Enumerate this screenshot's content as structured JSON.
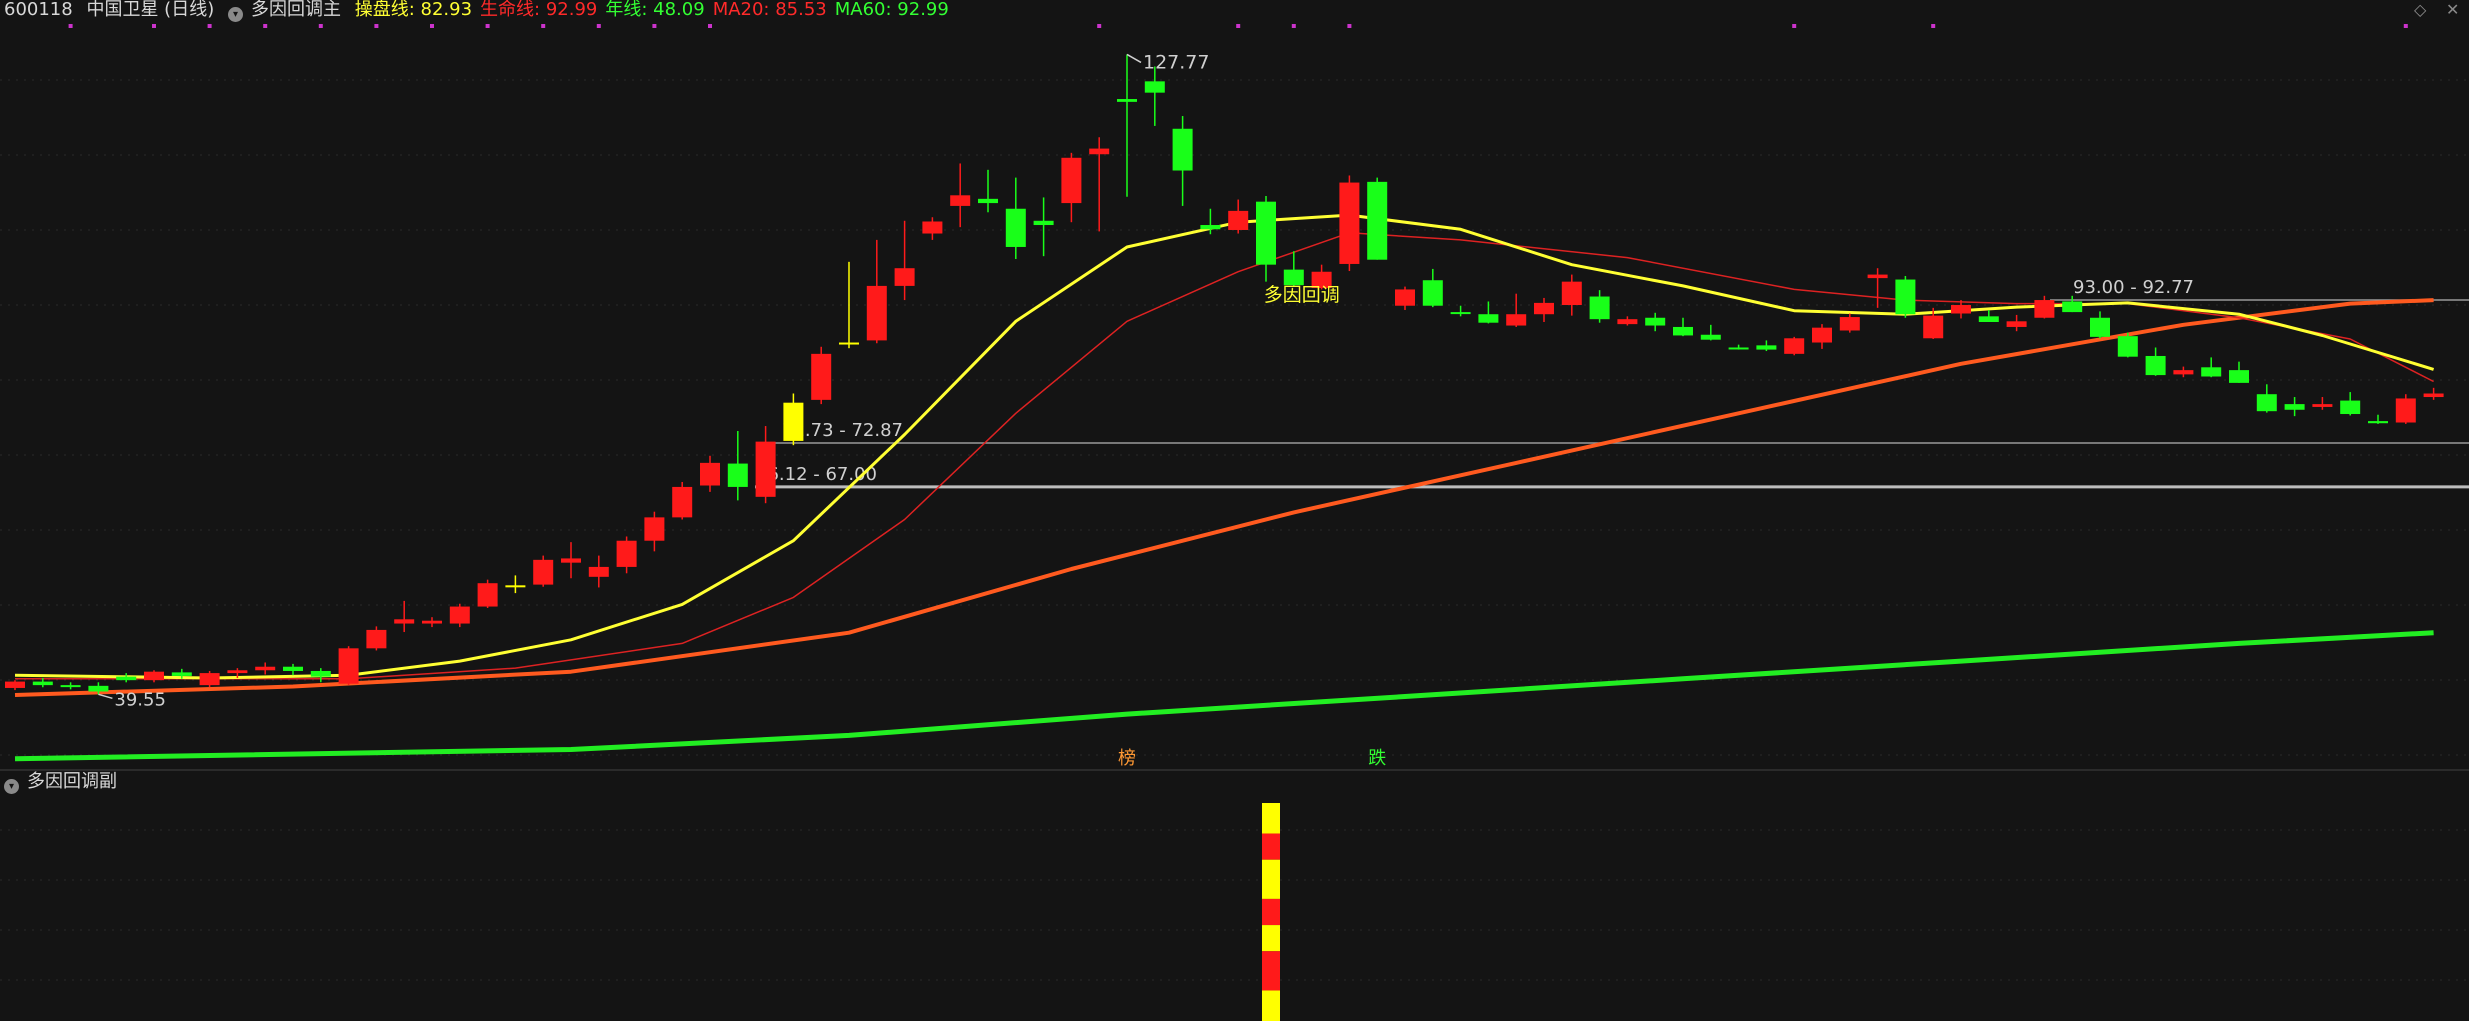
{
  "header": {
    "code": "600118",
    "name": "中国卫星 (日线)",
    "indicator": "多因回调主",
    "metrics": [
      {
        "label": "操盘线",
        "value": "82.93",
        "color": "#ffff33"
      },
      {
        "label": "生命线",
        "value": "92.99",
        "color": "#ff2a2a"
      },
      {
        "label": "年线",
        "value": "48.09",
        "color": "#33ff33"
      },
      {
        "label": "MA20",
        "value": "85.53",
        "color": "#ff2a2a"
      },
      {
        "label": "MA60",
        "value": "92.99",
        "color": "#33ff33"
      }
    ]
  },
  "sub_header": {
    "title": "多因回调副"
  },
  "icons": {
    "corner_left": "diamond-icon",
    "corner_right": "close-icon",
    "collapse": "chevron-down-icon"
  },
  "chart_data": {
    "type": "candlestick",
    "y_range": [
      30,
      132
    ],
    "colors": {
      "up": "#ff1a1a",
      "down": "#19ff19",
      "cross": "#ffff00",
      "line_yellow": "#ffff33",
      "line_red": "#dd2222",
      "line_orange": "#ff5a1f",
      "line_green": "#22ee22",
      "marker": "#cc33cc"
    },
    "candles": [
      [
        38.2,
        39.3,
        37.9,
        39.1
      ],
      [
        39.1,
        39.6,
        38.3,
        38.6
      ],
      [
        38.6,
        39.0,
        38.0,
        38.5
      ],
      [
        38.5,
        39.0,
        37.3,
        37.7
      ],
      [
        39.8,
        40.3,
        39.0,
        39.3
      ],
      [
        39.3,
        40.7,
        39.0,
        40.5
      ],
      [
        40.4,
        40.9,
        39.5,
        39.9
      ],
      [
        38.6,
        40.6,
        38.3,
        40.3
      ],
      [
        40.3,
        41.0,
        39.6,
        40.7
      ],
      [
        40.7,
        41.8,
        40.1,
        41.2
      ],
      [
        41.2,
        41.6,
        40.0,
        40.6
      ],
      [
        40.6,
        41.0,
        39.0,
        39.8
      ],
      [
        38.8,
        44.1,
        38.6,
        43.8
      ],
      [
        43.8,
        46.9,
        43.5,
        46.4
      ],
      [
        47.3,
        50.5,
        46.1,
        47.9
      ],
      [
        47.3,
        48.2,
        46.8,
        47.7
      ],
      [
        47.3,
        50.1,
        46.8,
        49.7
      ],
      [
        49.7,
        53.5,
        49.5,
        53.0
      ],
      [
        52.7,
        54.1,
        51.6,
        52.7
      ],
      [
        52.8,
        56.9,
        52.5,
        56.3
      ],
      [
        55.9,
        58.8,
        53.7,
        56.5
      ],
      [
        53.9,
        56.9,
        52.4,
        55.3
      ],
      [
        55.3,
        59.6,
        54.4,
        59.0
      ],
      [
        59.0,
        63.1,
        57.5,
        62.3
      ],
      [
        62.3,
        67.3,
        62.0,
        66.6
      ],
      [
        66.8,
        71.0,
        65.9,
        70.0
      ],
      [
        69.9,
        74.5,
        64.7,
        66.6
      ],
      [
        65.2,
        75.2,
        64.3,
        73.0
      ],
      [
        73.1,
        79.8,
        72.5,
        78.5
      ],
      [
        78.9,
        86.4,
        78.3,
        85.4
      ],
      [
        87.0,
        98.4,
        86.2,
        87.0
      ],
      [
        87.3,
        101.5,
        86.9,
        95.0
      ],
      [
        95.0,
        104.2,
        93.0,
        97.5
      ],
      [
        102.4,
        104.7,
        101.5,
        104.1
      ],
      [
        106.3,
        112.3,
        103.3,
        107.8
      ],
      [
        107.3,
        111.4,
        105.4,
        106.7
      ],
      [
        105.9,
        110.3,
        98.8,
        100.5
      ],
      [
        104.2,
        107.5,
        99.2,
        103.6
      ],
      [
        106.7,
        113.8,
        104.0,
        113.1
      ],
      [
        113.6,
        116.0,
        102.7,
        114.4
      ],
      [
        121.4,
        127.7,
        107.6,
        121.0
      ],
      [
        123.9,
        126.0,
        117.6,
        122.3
      ],
      [
        117.2,
        119.0,
        106.3,
        111.3
      ],
      [
        103.6,
        105.9,
        102.3,
        103.0
      ],
      [
        102.9,
        107.2,
        102.4,
        105.6
      ],
      [
        106.9,
        107.7,
        95.6,
        98.0
      ],
      [
        97.3,
        99.9,
        94.9,
        95.1
      ],
      [
        94.7,
        98.0,
        94.5,
        97.0
      ],
      [
        98.1,
        110.6,
        97.1,
        109.6
      ],
      [
        109.7,
        110.3,
        98.7,
        98.7
      ],
      [
        92.2,
        94.9,
        91.6,
        94.5
      ],
      [
        95.8,
        97.4,
        92.0,
        92.2
      ],
      [
        91.3,
        92.2,
        90.7,
        91.2
      ],
      [
        91.0,
        92.8,
        89.7,
        89.8
      ],
      [
        89.4,
        93.9,
        89.2,
        91.0
      ],
      [
        91.0,
        93.3,
        89.9,
        92.6
      ],
      [
        92.3,
        96.6,
        90.8,
        95.6
      ],
      [
        93.5,
        94.4,
        89.8,
        90.3
      ],
      [
        89.6,
        90.7,
        89.4,
        90.3
      ],
      [
        90.5,
        91.2,
        88.6,
        89.4
      ],
      [
        89.2,
        90.5,
        87.9,
        88.0
      ],
      [
        88.1,
        89.5,
        87.3,
        87.4
      ],
      [
        86.3,
        86.7,
        86.0,
        86.1
      ],
      [
        86.6,
        87.3,
        85.8,
        86.0
      ],
      [
        85.4,
        87.8,
        85.2,
        87.6
      ],
      [
        87.0,
        89.6,
        86.1,
        89.1
      ],
      [
        88.7,
        91.1,
        88.4,
        90.6
      ],
      [
        96.1,
        97.5,
        91.9,
        96.6
      ],
      [
        95.9,
        96.4,
        90.5,
        91.0
      ],
      [
        87.6,
        91.9,
        87.5,
        90.8
      ],
      [
        91.1,
        93.0,
        90.4,
        92.3
      ],
      [
        90.7,
        91.6,
        89.9,
        89.9
      ],
      [
        89.2,
        90.9,
        88.6,
        90.0
      ],
      [
        90.5,
        93.6,
        90.4,
        93.0
      ],
      [
        92.8,
        93.6,
        91.3,
        91.3
      ],
      [
        90.5,
        91.4,
        87.6,
        87.8
      ],
      [
        87.9,
        88.4,
        84.9,
        85.0
      ],
      [
        85.1,
        86.3,
        82.3,
        82.4
      ],
      [
        82.5,
        83.6,
        82.1,
        83.1
      ],
      [
        83.5,
        84.9,
        82.1,
        82.2
      ],
      [
        83.1,
        84.3,
        81.3,
        81.3
      ],
      [
        79.7,
        81.1,
        77.1,
        77.3
      ],
      [
        78.3,
        79.3,
        76.6,
        77.5
      ],
      [
        77.9,
        79.3,
        77.5,
        78.3
      ],
      [
        78.8,
        80.0,
        76.7,
        76.9
      ],
      [
        75.9,
        76.8,
        75.5,
        75.6
      ],
      [
        75.7,
        79.7,
        75.5,
        79.1
      ],
      [
        79.3,
        80.6,
        78.9,
        79.8
      ]
    ],
    "hlines": [
      {
        "label": "93.00 - 92.77",
        "y": 93.0
      },
      {
        "label": "72.73 - 72.87",
        "y": 72.8
      },
      {
        "label": "66.12 - 67.00",
        "y": 66.6
      }
    ],
    "annotations": [
      {
        "text": "127.77",
        "x": 40,
        "y": 127.7,
        "kind": "high"
      },
      {
        "text": "39.55",
        "x": 3,
        "y": 37.3,
        "kind": "low"
      },
      {
        "text": "多因回调",
        "x": 46,
        "y": 94.0,
        "kind": "signal"
      }
    ],
    "bottom_labels": [
      {
        "text": "榜",
        "x": 40,
        "color": "#ff9933"
      },
      {
        "text": "跌",
        "x": 49,
        "color": "#33ff33"
      }
    ],
    "top_markers": [
      2,
      5,
      7,
      9,
      11,
      13,
      15,
      17,
      19,
      21,
      23,
      25,
      39,
      44,
      46,
      48,
      64,
      69,
      86
    ],
    "lines": {
      "ma_yellow": [
        [
          0,
          40.0
        ],
        [
          7,
          39.6
        ],
        [
          12,
          40.0
        ],
        [
          16,
          42.0
        ],
        [
          20,
          45.0
        ],
        [
          24,
          50.0
        ],
        [
          28,
          59.0
        ],
        [
          32,
          74.0
        ],
        [
          36,
          90.0
        ],
        [
          40,
          100.5
        ],
        [
          44,
          104.0
        ],
        [
          48,
          105.0
        ],
        [
          52,
          103.0
        ],
        [
          56,
          98.0
        ],
        [
          60,
          95.0
        ],
        [
          64,
          91.5
        ],
        [
          68,
          91.0
        ],
        [
          72,
          92.0
        ],
        [
          76,
          92.6
        ],
        [
          80,
          91.0
        ],
        [
          83,
          88.0
        ],
        [
          87,
          83.2
        ]
      ],
      "ma_red": [
        [
          0,
          39.5
        ],
        [
          12,
          39.5
        ],
        [
          18,
          41.0
        ],
        [
          24,
          44.5
        ],
        [
          28,
          51.0
        ],
        [
          32,
          62.0
        ],
        [
          36,
          77.0
        ],
        [
          40,
          90.0
        ],
        [
          44,
          97.0
        ],
        [
          48,
          102.5
        ],
        [
          52,
          101.5
        ],
        [
          58,
          99.0
        ],
        [
          64,
          94.5
        ],
        [
          68,
          93.0
        ],
        [
          72,
          92.5
        ],
        [
          76,
          92.5
        ],
        [
          80,
          90.5
        ],
        [
          84,
          87.5
        ],
        [
          87,
          81.5
        ]
      ],
      "ma_orange": [
        [
          0,
          37.2
        ],
        [
          10,
          38.4
        ],
        [
          20,
          40.5
        ],
        [
          30,
          46.0
        ],
        [
          38,
          55.0
        ],
        [
          46,
          63.0
        ],
        [
          54,
          70.0
        ],
        [
          62,
          77.0
        ],
        [
          70,
          84.0
        ],
        [
          78,
          89.5
        ],
        [
          84,
          92.5
        ],
        [
          87,
          93.0
        ]
      ],
      "ma_green": [
        [
          0,
          28.2
        ],
        [
          20,
          29.5
        ],
        [
          30,
          31.5
        ],
        [
          40,
          34.5
        ],
        [
          50,
          37.0
        ],
        [
          60,
          39.5
        ],
        [
          70,
          42.0
        ],
        [
          80,
          44.5
        ],
        [
          87,
          46.0
        ]
      ]
    },
    "sub": {
      "bar_x": 45,
      "segments": [
        [
          0,
          14,
          "#ffff00"
        ],
        [
          14,
          26,
          "#ff1a1a"
        ],
        [
          26,
          44,
          "#ffff00"
        ],
        [
          44,
          56,
          "#ff1a1a"
        ],
        [
          56,
          68,
          "#ffff00"
        ],
        [
          68,
          86,
          "#ff1a1a"
        ],
        [
          86,
          100,
          "#ffff00"
        ]
      ]
    }
  }
}
